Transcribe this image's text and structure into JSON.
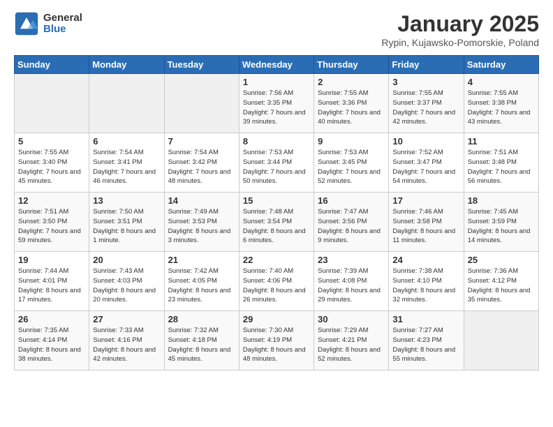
{
  "header": {
    "logo_general": "General",
    "logo_blue": "Blue",
    "title": "January 2025",
    "location": "Rypin, Kujawsko-Pomorskie, Poland"
  },
  "days_of_week": [
    "Sunday",
    "Monday",
    "Tuesday",
    "Wednesday",
    "Thursday",
    "Friday",
    "Saturday"
  ],
  "weeks": [
    [
      {
        "day": "",
        "info": ""
      },
      {
        "day": "",
        "info": ""
      },
      {
        "day": "",
        "info": ""
      },
      {
        "day": "1",
        "info": "Sunrise: 7:56 AM\nSunset: 3:35 PM\nDaylight: 7 hours\nand 39 minutes."
      },
      {
        "day": "2",
        "info": "Sunrise: 7:55 AM\nSunset: 3:36 PM\nDaylight: 7 hours\nand 40 minutes."
      },
      {
        "day": "3",
        "info": "Sunrise: 7:55 AM\nSunset: 3:37 PM\nDaylight: 7 hours\nand 42 minutes."
      },
      {
        "day": "4",
        "info": "Sunrise: 7:55 AM\nSunset: 3:38 PM\nDaylight: 7 hours\nand 43 minutes."
      }
    ],
    [
      {
        "day": "5",
        "info": "Sunrise: 7:55 AM\nSunset: 3:40 PM\nDaylight: 7 hours\nand 45 minutes."
      },
      {
        "day": "6",
        "info": "Sunrise: 7:54 AM\nSunset: 3:41 PM\nDaylight: 7 hours\nand 46 minutes."
      },
      {
        "day": "7",
        "info": "Sunrise: 7:54 AM\nSunset: 3:42 PM\nDaylight: 7 hours\nand 48 minutes."
      },
      {
        "day": "8",
        "info": "Sunrise: 7:53 AM\nSunset: 3:44 PM\nDaylight: 7 hours\nand 50 minutes."
      },
      {
        "day": "9",
        "info": "Sunrise: 7:53 AM\nSunset: 3:45 PM\nDaylight: 7 hours\nand 52 minutes."
      },
      {
        "day": "10",
        "info": "Sunrise: 7:52 AM\nSunset: 3:47 PM\nDaylight: 7 hours\nand 54 minutes."
      },
      {
        "day": "11",
        "info": "Sunrise: 7:51 AM\nSunset: 3:48 PM\nDaylight: 7 hours\nand 56 minutes."
      }
    ],
    [
      {
        "day": "12",
        "info": "Sunrise: 7:51 AM\nSunset: 3:50 PM\nDaylight: 7 hours\nand 59 minutes."
      },
      {
        "day": "13",
        "info": "Sunrise: 7:50 AM\nSunset: 3:51 PM\nDaylight: 8 hours\nand 1 minute."
      },
      {
        "day": "14",
        "info": "Sunrise: 7:49 AM\nSunset: 3:53 PM\nDaylight: 8 hours\nand 3 minutes."
      },
      {
        "day": "15",
        "info": "Sunrise: 7:48 AM\nSunset: 3:54 PM\nDaylight: 8 hours\nand 6 minutes."
      },
      {
        "day": "16",
        "info": "Sunrise: 7:47 AM\nSunset: 3:56 PM\nDaylight: 8 hours\nand 9 minutes."
      },
      {
        "day": "17",
        "info": "Sunrise: 7:46 AM\nSunset: 3:58 PM\nDaylight: 8 hours\nand 11 minutes."
      },
      {
        "day": "18",
        "info": "Sunrise: 7:45 AM\nSunset: 3:59 PM\nDaylight: 8 hours\nand 14 minutes."
      }
    ],
    [
      {
        "day": "19",
        "info": "Sunrise: 7:44 AM\nSunset: 4:01 PM\nDaylight: 8 hours\nand 17 minutes."
      },
      {
        "day": "20",
        "info": "Sunrise: 7:43 AM\nSunset: 4:03 PM\nDaylight: 8 hours\nand 20 minutes."
      },
      {
        "day": "21",
        "info": "Sunrise: 7:42 AM\nSunset: 4:05 PM\nDaylight: 8 hours\nand 23 minutes."
      },
      {
        "day": "22",
        "info": "Sunrise: 7:40 AM\nSunset: 4:06 PM\nDaylight: 8 hours\nand 26 minutes."
      },
      {
        "day": "23",
        "info": "Sunrise: 7:39 AM\nSunset: 4:08 PM\nDaylight: 8 hours\nand 29 minutes."
      },
      {
        "day": "24",
        "info": "Sunrise: 7:38 AM\nSunset: 4:10 PM\nDaylight: 8 hours\nand 32 minutes."
      },
      {
        "day": "25",
        "info": "Sunrise: 7:36 AM\nSunset: 4:12 PM\nDaylight: 8 hours\nand 35 minutes."
      }
    ],
    [
      {
        "day": "26",
        "info": "Sunrise: 7:35 AM\nSunset: 4:14 PM\nDaylight: 8 hours\nand 38 minutes."
      },
      {
        "day": "27",
        "info": "Sunrise: 7:33 AM\nSunset: 4:16 PM\nDaylight: 8 hours\nand 42 minutes."
      },
      {
        "day": "28",
        "info": "Sunrise: 7:32 AM\nSunset: 4:18 PM\nDaylight: 8 hours\nand 45 minutes."
      },
      {
        "day": "29",
        "info": "Sunrise: 7:30 AM\nSunset: 4:19 PM\nDaylight: 8 hours\nand 48 minutes."
      },
      {
        "day": "30",
        "info": "Sunrise: 7:29 AM\nSunset: 4:21 PM\nDaylight: 8 hours\nand 52 minutes."
      },
      {
        "day": "31",
        "info": "Sunrise: 7:27 AM\nSunset: 4:23 PM\nDaylight: 8 hours\nand 55 minutes."
      },
      {
        "day": "",
        "info": ""
      }
    ]
  ]
}
